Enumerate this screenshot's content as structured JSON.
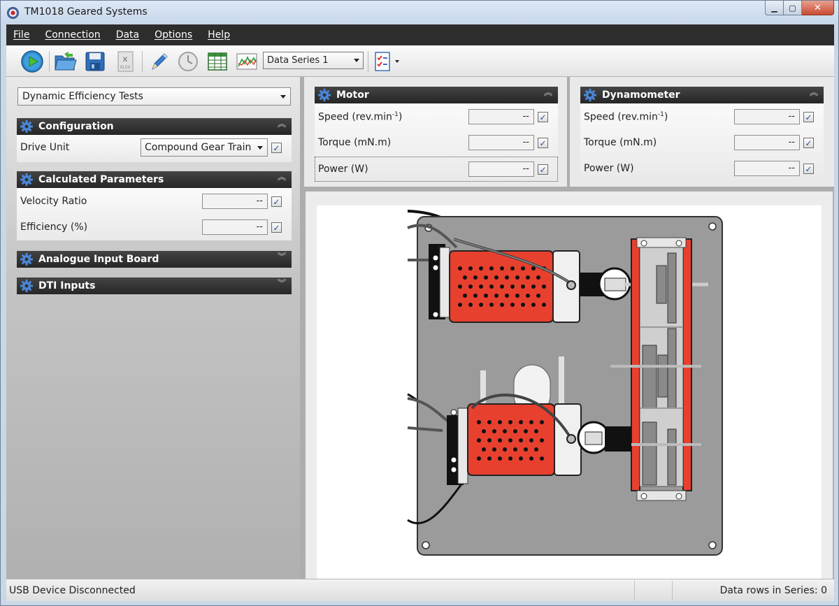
{
  "window": {
    "title": "TM1018 Geared Systems"
  },
  "menu": [
    "File",
    "Connection",
    "Data",
    "Options",
    "Help"
  ],
  "toolbar": {
    "icons": [
      "play-icon",
      "open-folder-icon",
      "save-icon",
      "export-xlsx-icon",
      "pencil-icon",
      "clock-icon",
      "table-icon",
      "chart-icon",
      "checklist-icon"
    ],
    "series_select": "Data Series 1"
  },
  "left": {
    "mode_select": "Dynamic Efficiency Tests",
    "configuration": {
      "title": "Configuration",
      "drive_unit_label": "Drive Unit",
      "drive_unit_value": "Compound Gear Train"
    },
    "calculated": {
      "title": "Calculated Parameters",
      "velocity_ratio_label": "Velocity Ratio",
      "velocity_ratio_value": "--",
      "efficiency_label": "Efficiency  (%)",
      "efficiency_value": "--"
    },
    "analogue": {
      "title": "Analogue Input Board"
    },
    "dti": {
      "title": "DTI Inputs"
    }
  },
  "motor": {
    "title": "Motor",
    "speed_label": "Speed  (rev.min",
    "speed_sup": "-1",
    "speed_close": ")",
    "speed_value": "--",
    "torque_label": "Torque  (mN.m)",
    "torque_value": "--",
    "power_label": "Power  (W)",
    "power_value": "--"
  },
  "dynamometer": {
    "title": "Dynamometer",
    "speed_label": "Speed  (rev.min",
    "speed_sup": "-1",
    "speed_close": ")",
    "speed_value": "--",
    "torque_label": "Torque  (mN.m)",
    "torque_value": "--",
    "power_label": "Power  (W)",
    "power_value": "--"
  },
  "status": {
    "left": "USB Device Disconnected",
    "right": "Data rows in Series: 0"
  },
  "colors": {
    "menubar": "#2d2d2d",
    "panel_header": "#333333",
    "motor_red": "#e8402e",
    "plate": "#9b9b9b"
  }
}
